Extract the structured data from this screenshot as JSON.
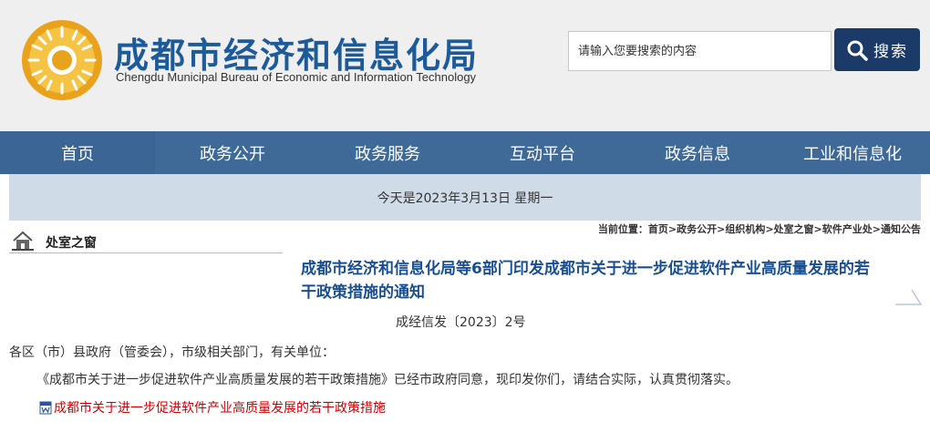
{
  "header": {
    "title": "成都市经济和信息化局",
    "subtitle": "Chengdu Municipal Bureau of Economic and Information Technology",
    "search_placeholder": "请输入您要搜索的内容",
    "search_button": "搜索"
  },
  "nav": {
    "items": [
      {
        "label": "首页"
      },
      {
        "label": "政务公开"
      },
      {
        "label": "政务服务"
      },
      {
        "label": "互动平台"
      },
      {
        "label": "政务信息"
      },
      {
        "label": "工业和信息化"
      }
    ]
  },
  "date_text": "今天是2023年3月13日 星期一",
  "sidebar": {
    "title": "处室之窗"
  },
  "breadcrumb": {
    "label": "当前位置：",
    "path": "首页>政务公开>组织机构>处室之窗>软件产业处>通知公告"
  },
  "article": {
    "title": "成都市经济和信息化局等6部门印发成都市关于进一步促进软件产业高质量发展的若干政策措施的通知",
    "doc_number": "成经信发〔2023〕2号",
    "salutation": "各区（市）县政府（管委会），市级相关部门，有关单位：",
    "body": "《成都市关于进一步促进软件产业高质量发展的若干政策措施》已经市政府同意，现印发你们，请结合实际，认真贯彻落实。",
    "attachment_label": "成都市关于进一步促进软件产业高质量发展的若干政策措施"
  },
  "colors": {
    "brand_blue": "#1d5a9a",
    "nav_bg": "#3f6a98",
    "date_bar_bg": "#cfdbe7",
    "search_button_bg": "#1c3a68",
    "link_red": "#cc0000"
  }
}
